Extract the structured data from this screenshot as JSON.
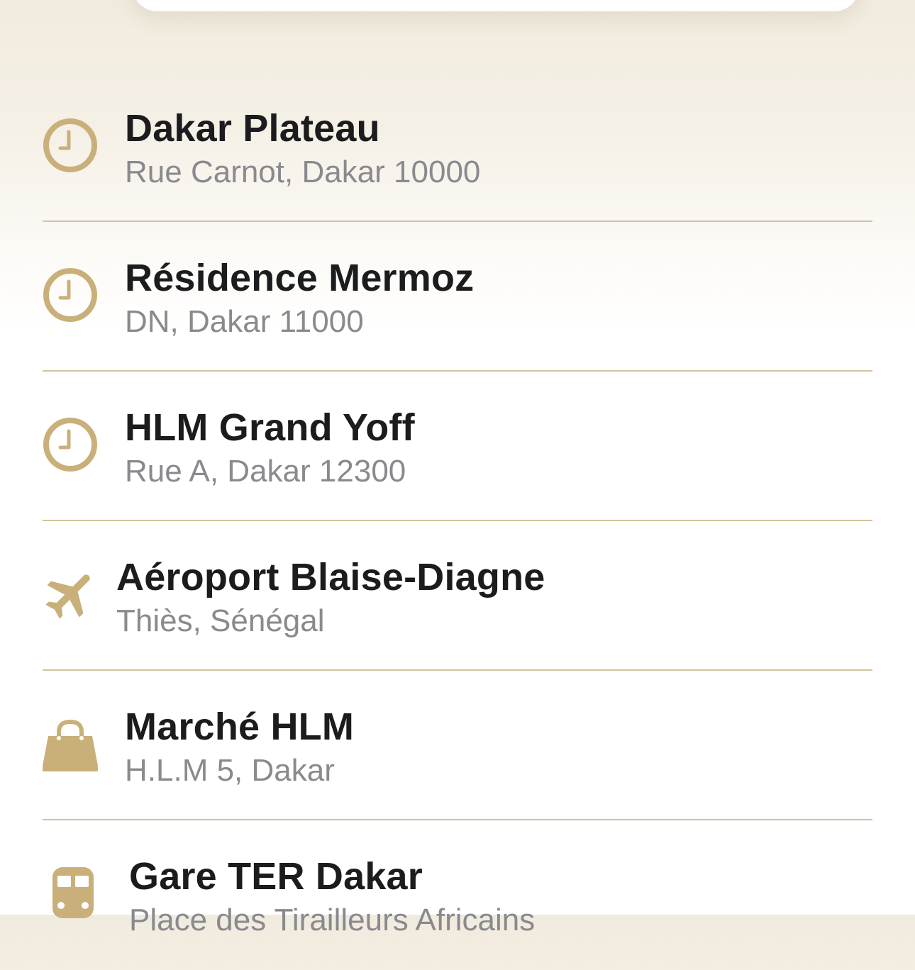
{
  "colors": {
    "accent": "#c9b07a",
    "title": "#1c1c1e",
    "subtitle": "#8a8a8e",
    "divider": "#d2c3a0"
  },
  "results": [
    {
      "title": "Dakar Plateau",
      "subtitle": "Rue Carnot, Dakar 10000",
      "icon": "clock-icon"
    },
    {
      "title": "Résidence Mermoz",
      "subtitle": "DN, Dakar 11000",
      "icon": "clock-icon"
    },
    {
      "title": "HLM Grand Yoff",
      "subtitle": "Rue A, Dakar 12300",
      "icon": "clock-icon"
    },
    {
      "title": "Aéroport Blaise-Diagne",
      "subtitle": "Thiès, Sénégal",
      "icon": "airplane-icon"
    },
    {
      "title": "Marché HLM",
      "subtitle": "H.L.M 5, Dakar",
      "icon": "shopping-bag-icon"
    },
    {
      "title": "Gare TER Dakar",
      "subtitle": "Place des Tirailleurs Africains",
      "icon": "train-icon"
    }
  ]
}
